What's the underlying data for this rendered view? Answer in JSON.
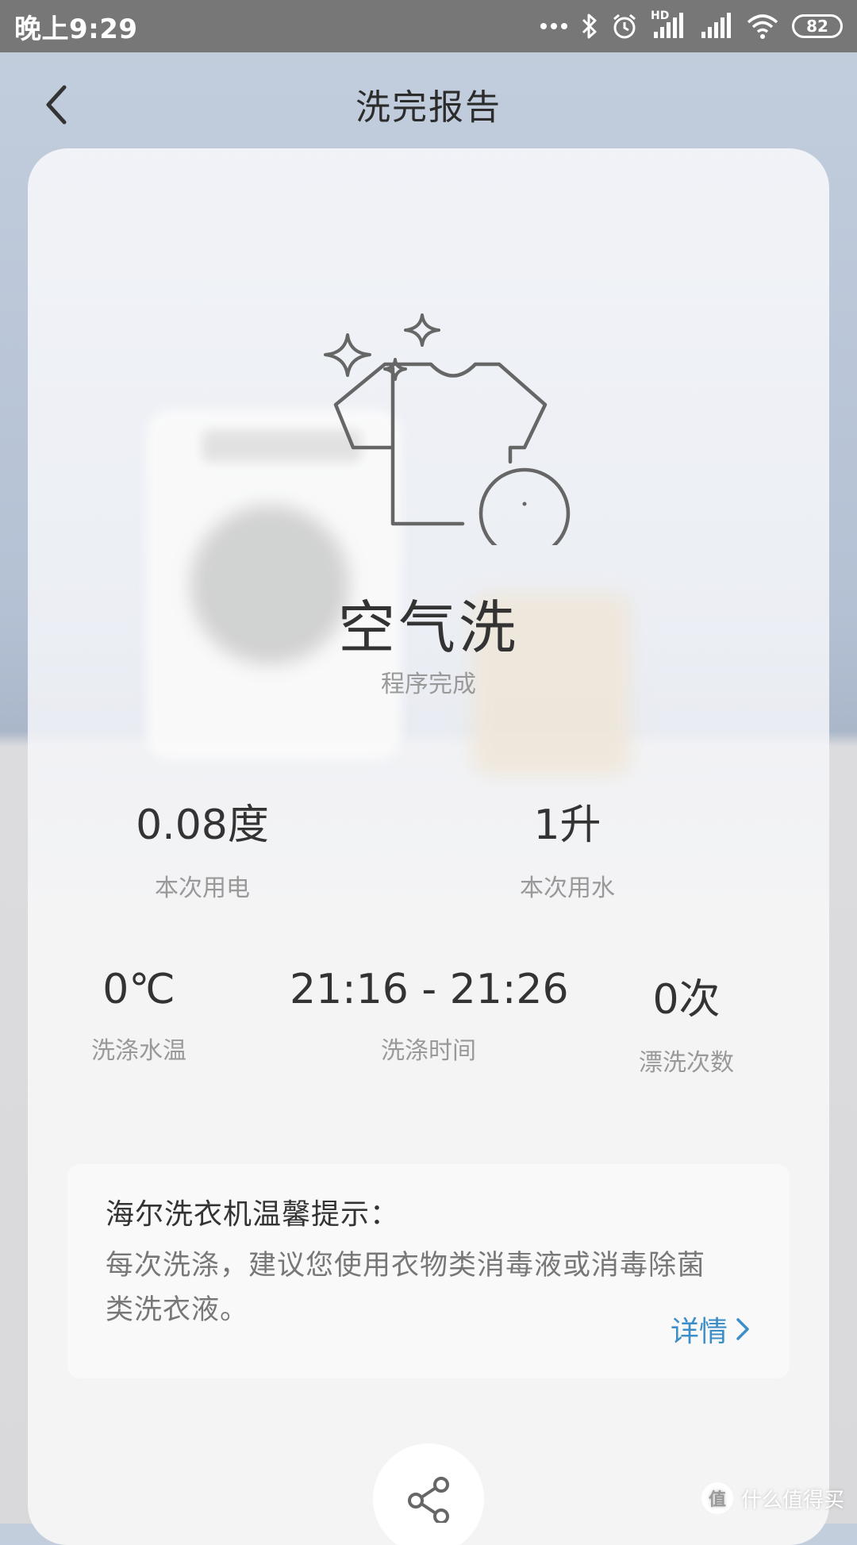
{
  "status_bar": {
    "time": "晚上9:29",
    "network_label": "HD",
    "battery_level": "82"
  },
  "header": {
    "title": "洗完报告"
  },
  "program": {
    "name": "空气洗",
    "status": "程序完成"
  },
  "stats_top": [
    {
      "value": "0.08度",
      "label": "本次用电"
    },
    {
      "value": "1升",
      "label": "本次用水"
    }
  ],
  "stats_bottom": [
    {
      "value": "0℃",
      "label": "洗涤水温"
    },
    {
      "value": "21:16 - 21:26",
      "label": "洗涤时间"
    },
    {
      "value": "0次",
      "label": "漂洗次数"
    }
  ],
  "tip": {
    "title": "海尔洗衣机温馨提示：",
    "line1": "每次洗涤，建议您使用衣物类消毒液或消毒除菌",
    "line2": "类洗衣液。",
    "details_label": "详情"
  },
  "watermark": {
    "logo_text": "值",
    "text": "什么值得买"
  },
  "colors": {
    "status_bar": "#777777",
    "accent_link": "#3b8ec7",
    "primary_text": "#333333",
    "secondary_text": "#999999"
  },
  "icons": {
    "back": "chevron-left-icon",
    "hero": "tshirt-sparkle-icon",
    "share": "share-icon",
    "details": "chevron-right-icon"
  }
}
